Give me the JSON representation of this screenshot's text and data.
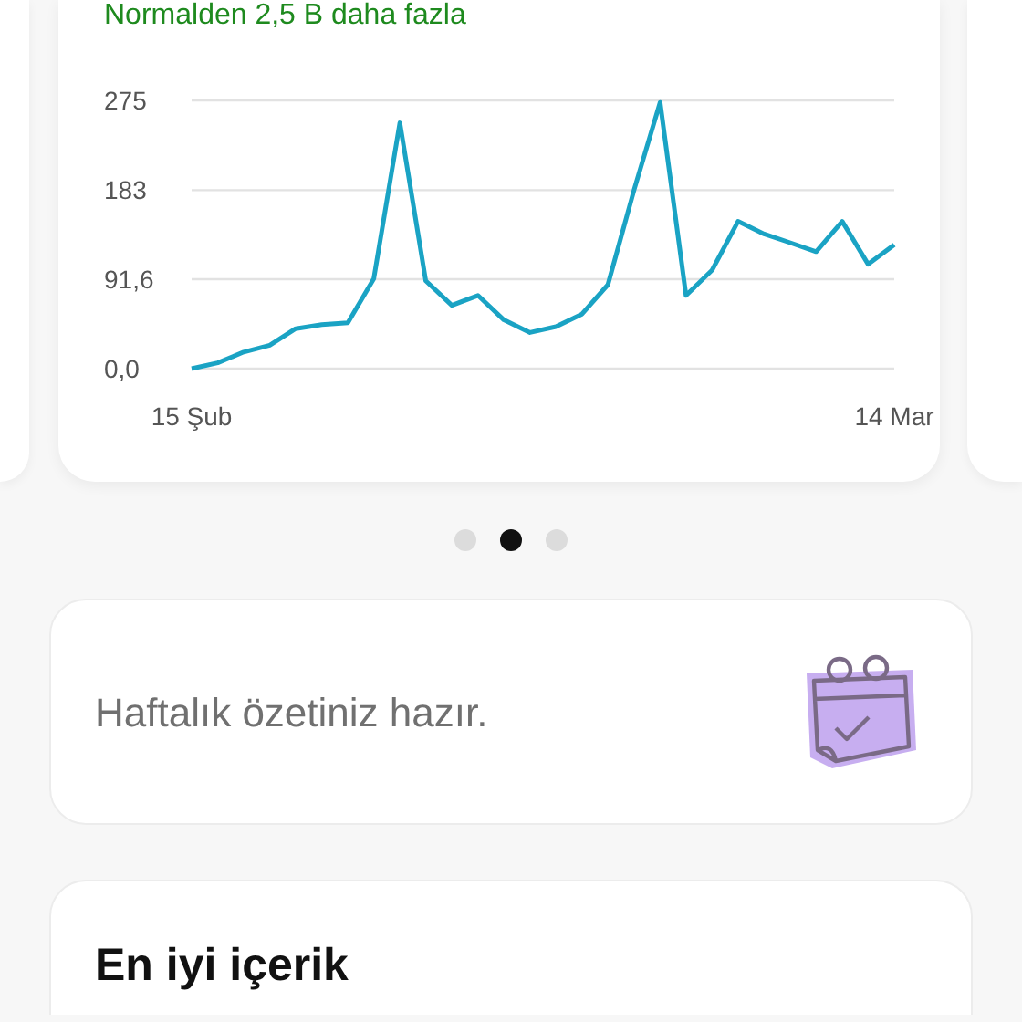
{
  "chart_card": {
    "comparison": "Normalden 2,5 B daha fazla",
    "chart_data": {
      "type": "line",
      "categories": [
        "15 Şub",
        null,
        null,
        null,
        null,
        null,
        null,
        null,
        null,
        null,
        null,
        null,
        null,
        null,
        null,
        null,
        null,
        null,
        null,
        null,
        null,
        null,
        null,
        null,
        null,
        null,
        null,
        "14 Mar"
      ],
      "series": [
        {
          "color": "#1aa3c4",
          "values": [
            0,
            6,
            17,
            24,
            41,
            45,
            47,
            92,
            252,
            90,
            65,
            75,
            50,
            37,
            43,
            56,
            86,
            183,
            273,
            75,
            101,
            151,
            138,
            129,
            120,
            151,
            107,
            127
          ]
        }
      ],
      "ylim": [
        0,
        275
      ],
      "yticks": [
        {
          "value": 0,
          "label": "0,0"
        },
        {
          "value": 91.6,
          "label": "91,6"
        },
        {
          "value": 183,
          "label": "183"
        },
        {
          "value": 275,
          "label": "275"
        }
      ]
    }
  },
  "carousel_dots": [
    {
      "selected": false
    },
    {
      "selected": true
    },
    {
      "selected": false
    }
  ],
  "summary_card": {
    "text": "Haftalık özetiniz hazır."
  },
  "top_content_card": {
    "title": "En iyi içerik"
  }
}
